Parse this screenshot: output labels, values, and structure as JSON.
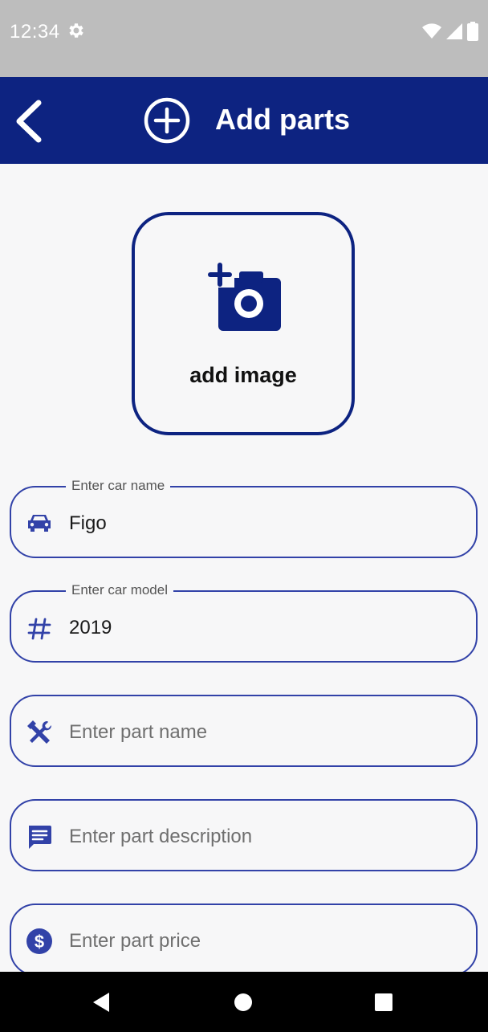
{
  "status_bar": {
    "time": "12:34",
    "icons": [
      "settings-icon",
      "wifi-icon",
      "signal-icon",
      "battery-icon"
    ]
  },
  "app_bar": {
    "title": "Add parts",
    "back_icon": "back-arrow-icon",
    "title_icon": "add-circle-icon",
    "background_color": "#0d2381"
  },
  "add_image": {
    "label": "add image",
    "icon": "add-camera-icon"
  },
  "fields": [
    {
      "name": "car-name",
      "label": "Enter car name",
      "value": "Figo",
      "placeholder": "",
      "icon": "car-icon"
    },
    {
      "name": "car-model",
      "label": "Enter car model",
      "value": "2019",
      "placeholder": "",
      "icon": "hash-icon"
    },
    {
      "name": "part-name",
      "label": "",
      "value": "",
      "placeholder": "Enter part name",
      "icon": "tools-icon"
    },
    {
      "name": "part-description",
      "label": "",
      "value": "",
      "placeholder": "Enter part description",
      "icon": "comment-icon"
    },
    {
      "name": "part-price",
      "label": "",
      "value": "",
      "placeholder": "Enter part price",
      "icon": "dollar-icon"
    }
  ],
  "nav_bar": {
    "icons": [
      "back-triangle-icon",
      "home-circle-icon",
      "recents-square-icon"
    ]
  }
}
